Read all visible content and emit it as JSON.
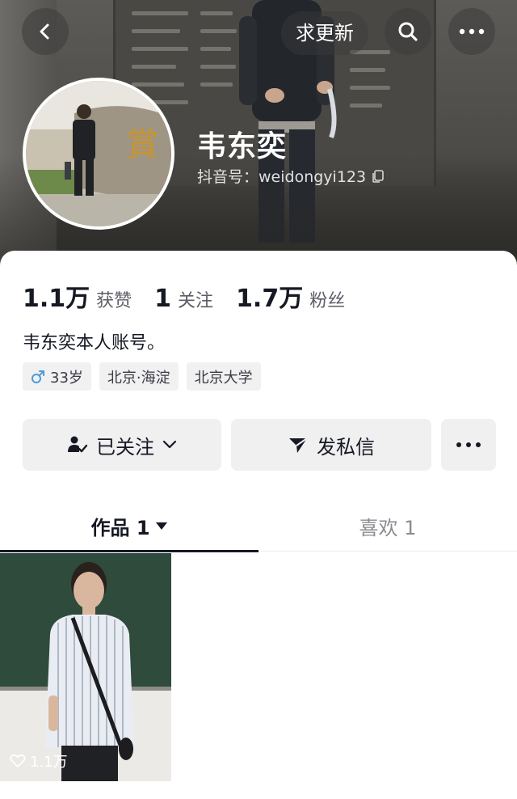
{
  "header": {
    "update_label": "求更新",
    "name": "韦东奕",
    "douyin_id": "抖音号：weidongyi123"
  },
  "stats": [
    {
      "value": "1.1万",
      "label": "获赞"
    },
    {
      "value": "1",
      "label": "关注"
    },
    {
      "value": "1.7万",
      "label": "粉丝"
    }
  ],
  "bio": "韦东奕本人账号。",
  "tags": {
    "age": "33岁",
    "location": "北京·海淀",
    "school": "北京大学"
  },
  "actions": {
    "follow_label": "已关注",
    "message_label": "发私信"
  },
  "tabs": {
    "works": "作品 1",
    "likes": "喜欢 1"
  },
  "works": [
    {
      "likes": "1.1万"
    }
  ],
  "icons": {
    "back": "chevron-left-icon",
    "search": "search-icon",
    "more": "more-dots-icon",
    "copy": "copy-icon",
    "gender": "male-icon",
    "followed": "user-check-icon",
    "dropdown": "chevron-down-icon",
    "send": "paper-plane-icon",
    "tab_dropdown": "triangle-down-icon",
    "heart": "heart-icon"
  },
  "colors": {
    "text_primary": "#161823",
    "text_secondary": "#5c5d66",
    "male_blue": "#4c9bd6",
    "button_bg": "#f0f0f1"
  }
}
